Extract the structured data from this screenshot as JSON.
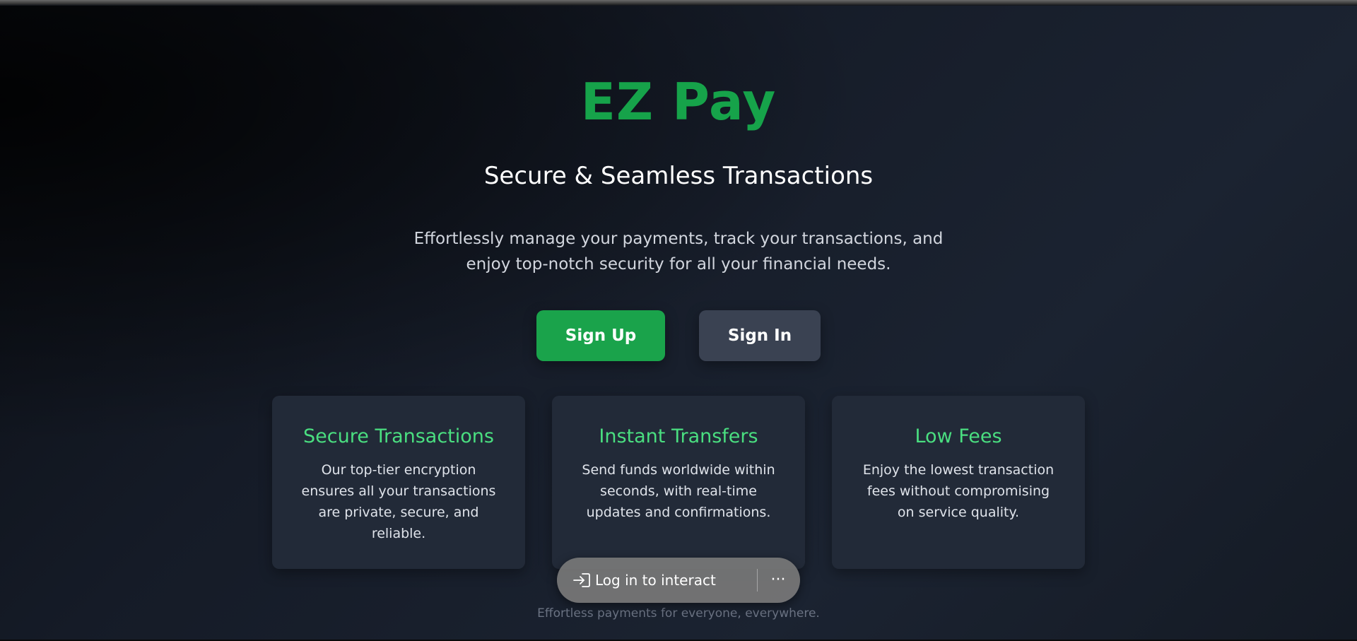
{
  "colors": {
    "brand_green": "#16a34a",
    "card_title_green": "#4ade80",
    "signup_bg": "#1aa34b",
    "signin_bg": "#3a4252"
  },
  "hero": {
    "brand": "EZ Pay",
    "tagline": "Secure & Seamless Transactions",
    "description": "Effortlessly manage your payments, track your transactions, and enjoy top-notch security for all your financial needs."
  },
  "actions": {
    "signup_label": "Sign Up",
    "signin_label": "Sign In"
  },
  "features": [
    {
      "title": "Secure Transactions",
      "text": "Our top-tier encryption ensures all your transactions are private, secure, and reliable."
    },
    {
      "title": "Instant Transfers",
      "text": "Send funds worldwide within seconds, with real-time updates and confirmations."
    },
    {
      "title": "Low Fees",
      "text": "Enjoy the lowest transaction fees without compromising on service quality."
    }
  ],
  "overlay": {
    "login_label": "Log in to interact",
    "icon": "login-arrow-icon",
    "more_icon": "more-horizontal-icon",
    "more_glyph": "···"
  },
  "footer": {
    "text": "Effortless payments for everyone, everywhere."
  }
}
